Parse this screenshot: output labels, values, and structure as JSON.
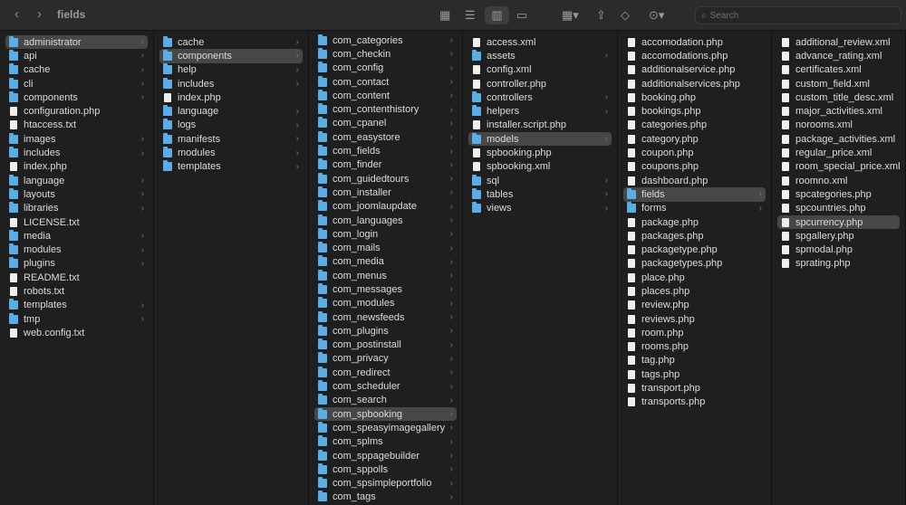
{
  "window": {
    "title": "fields",
    "search_placeholder": "Search"
  },
  "columns": [
    {
      "selected": "administrator",
      "items": [
        [
          "administrator",
          "d"
        ],
        [
          "api",
          "d"
        ],
        [
          "cache",
          "d"
        ],
        [
          "cli",
          "d"
        ],
        [
          "components",
          "d"
        ],
        [
          "configuration.php",
          "f"
        ],
        [
          "htaccess.txt",
          "f"
        ],
        [
          "images",
          "d"
        ],
        [
          "includes",
          "d"
        ],
        [
          "index.php",
          "f"
        ],
        [
          "language",
          "d"
        ],
        [
          "layouts",
          "d"
        ],
        [
          "libraries",
          "d"
        ],
        [
          "LICENSE.txt",
          "f"
        ],
        [
          "media",
          "d"
        ],
        [
          "modules",
          "d"
        ],
        [
          "plugins",
          "d"
        ],
        [
          "README.txt",
          "f"
        ],
        [
          "robots.txt",
          "f"
        ],
        [
          "templates",
          "d"
        ],
        [
          "tmp",
          "d"
        ],
        [
          "web.config.txt",
          "f"
        ]
      ]
    },
    {
      "selected": "components",
      "items": [
        [
          "cache",
          "d"
        ],
        [
          "components",
          "d"
        ],
        [
          "help",
          "d"
        ],
        [
          "includes",
          "d"
        ],
        [
          "index.php",
          "f"
        ],
        [
          "language",
          "d"
        ],
        [
          "logs",
          "d"
        ],
        [
          "manifests",
          "d"
        ],
        [
          "modules",
          "d"
        ],
        [
          "templates",
          "d"
        ]
      ]
    },
    {
      "selected": "com_spbooking",
      "items": [
        [
          "com_categories",
          "d"
        ],
        [
          "com_checkin",
          "d"
        ],
        [
          "com_config",
          "d"
        ],
        [
          "com_contact",
          "d"
        ],
        [
          "com_content",
          "d"
        ],
        [
          "com_contenthistory",
          "d"
        ],
        [
          "com_cpanel",
          "d"
        ],
        [
          "com_easystore",
          "d"
        ],
        [
          "com_fields",
          "d"
        ],
        [
          "com_finder",
          "d"
        ],
        [
          "com_guidedtours",
          "d"
        ],
        [
          "com_installer",
          "d"
        ],
        [
          "com_joomlaupdate",
          "d"
        ],
        [
          "com_languages",
          "d"
        ],
        [
          "com_login",
          "d"
        ],
        [
          "com_mails",
          "d"
        ],
        [
          "com_media",
          "d"
        ],
        [
          "com_menus",
          "d"
        ],
        [
          "com_messages",
          "d"
        ],
        [
          "com_modules",
          "d"
        ],
        [
          "com_newsfeeds",
          "d"
        ],
        [
          "com_plugins",
          "d"
        ],
        [
          "com_postinstall",
          "d"
        ],
        [
          "com_privacy",
          "d"
        ],
        [
          "com_redirect",
          "d"
        ],
        [
          "com_scheduler",
          "d"
        ],
        [
          "com_search",
          "d"
        ],
        [
          "com_spbooking",
          "d"
        ],
        [
          "com_speasyimagegallery",
          "d"
        ],
        [
          "com_splms",
          "d"
        ],
        [
          "com_sppagebuilder",
          "d"
        ],
        [
          "com_sppolls",
          "d"
        ],
        [
          "com_spsimpleportfolio",
          "d"
        ],
        [
          "com_tags",
          "d"
        ]
      ]
    },
    {
      "selected": "models",
      "items": [
        [
          "access.xml",
          "f"
        ],
        [
          "assets",
          "d"
        ],
        [
          "config.xml",
          "f"
        ],
        [
          "controller.php",
          "f"
        ],
        [
          "controllers",
          "d"
        ],
        [
          "helpers",
          "d"
        ],
        [
          "installer.script.php",
          "f"
        ],
        [
          "models",
          "d"
        ],
        [
          "spbooking.php",
          "f"
        ],
        [
          "spbooking.xml",
          "f"
        ],
        [
          "sql",
          "d"
        ],
        [
          "tables",
          "d"
        ],
        [
          "views",
          "d"
        ]
      ]
    },
    {
      "selected": "fields",
      "items": [
        [
          "accomodation.php",
          "f"
        ],
        [
          "accomodations.php",
          "f"
        ],
        [
          "additionalservice.php",
          "f"
        ],
        [
          "additionalservices.php",
          "f"
        ],
        [
          "booking.php",
          "f"
        ],
        [
          "bookings.php",
          "f"
        ],
        [
          "categories.php",
          "f"
        ],
        [
          "category.php",
          "f"
        ],
        [
          "coupon.php",
          "f"
        ],
        [
          "coupons.php",
          "f"
        ],
        [
          "dashboard.php",
          "f"
        ],
        [
          "fields",
          "d"
        ],
        [
          "forms",
          "d"
        ],
        [
          "package.php",
          "f"
        ],
        [
          "packages.php",
          "f"
        ],
        [
          "packagetype.php",
          "f"
        ],
        [
          "packagetypes.php",
          "f"
        ],
        [
          "place.php",
          "f"
        ],
        [
          "places.php",
          "f"
        ],
        [
          "review.php",
          "f"
        ],
        [
          "reviews.php",
          "f"
        ],
        [
          "room.php",
          "f"
        ],
        [
          "rooms.php",
          "f"
        ],
        [
          "tag.php",
          "f"
        ],
        [
          "tags.php",
          "f"
        ],
        [
          "transport.php",
          "f"
        ],
        [
          "transports.php",
          "f"
        ]
      ]
    },
    {
      "selected": "spcurrency.php",
      "items": [
        [
          "additional_review.xml",
          "f"
        ],
        [
          "advance_rating.xml",
          "f"
        ],
        [
          "certificates.xml",
          "f"
        ],
        [
          "custom_field.xml",
          "f"
        ],
        [
          "custom_title_desc.xml",
          "f"
        ],
        [
          "major_activities.xml",
          "f"
        ],
        [
          "norooms.xml",
          "f"
        ],
        [
          "package_activities.xml",
          "f"
        ],
        [
          "regular_price.xml",
          "f"
        ],
        [
          "room_special_price.xml",
          "f"
        ],
        [
          "roomno.xml",
          "f"
        ],
        [
          "spcategories.php",
          "f"
        ],
        [
          "spcountries.php",
          "f"
        ],
        [
          "spcurrency.php",
          "f"
        ],
        [
          "spgallery.php",
          "f"
        ],
        [
          "spmodal.php",
          "f"
        ],
        [
          "sprating.php",
          "f"
        ]
      ]
    }
  ]
}
